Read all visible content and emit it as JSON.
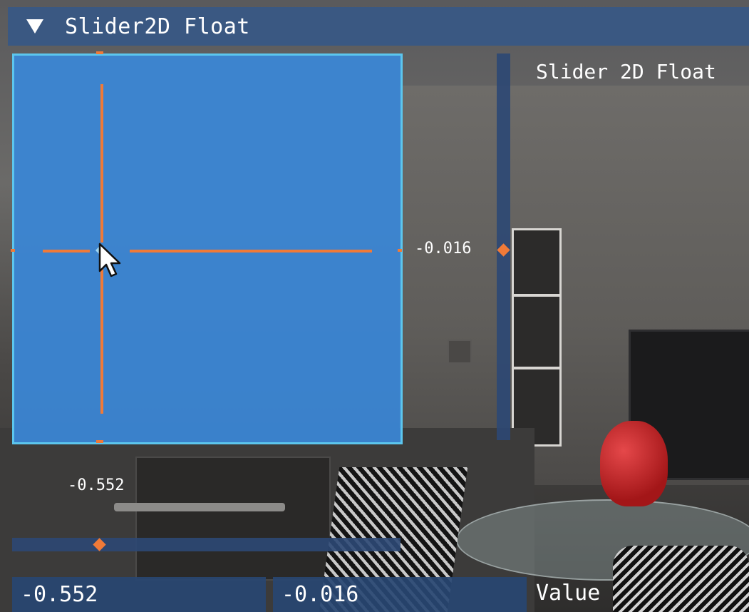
{
  "header": {
    "title": "Slider2D Float",
    "expanded": true
  },
  "slider2d": {
    "label": "Slider 2D Float",
    "x_value_text": "-0.552",
    "y_value_text": "-0.016",
    "x_value": -0.552,
    "y_value": -0.016
  },
  "inputs": {
    "x": "-0.552",
    "y": "-0.016",
    "label": "Value"
  },
  "colors": {
    "accent": "#f07a38",
    "pad_fill": "#3a86d6",
    "pad_border": "#5cc6ee",
    "header_bg": "#355888",
    "field_bg": "#28466f"
  },
  "icons": {
    "header_toggle": "triangle-down-icon",
    "pointer": "mouse-pointer-icon"
  }
}
